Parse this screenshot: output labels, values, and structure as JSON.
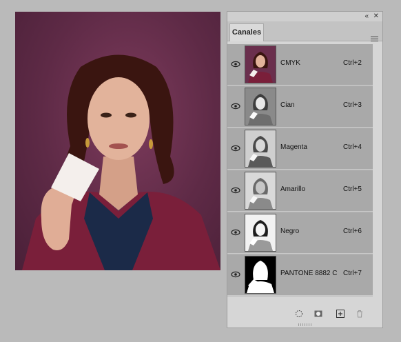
{
  "panel": {
    "tab_label": "Canales",
    "channels": [
      {
        "name": "CMYK",
        "shortcut": "Ctrl+2",
        "thumb": "color"
      },
      {
        "name": "Cian",
        "shortcut": "Ctrl+3",
        "thumb": "cyan"
      },
      {
        "name": "Magenta",
        "shortcut": "Ctrl+4",
        "thumb": "magenta"
      },
      {
        "name": "Amarillo",
        "shortcut": "Ctrl+5",
        "thumb": "yellow"
      },
      {
        "name": "Negro",
        "shortcut": "Ctrl+6",
        "thumb": "black"
      },
      {
        "name": "PANTONE 8882 C",
        "shortcut": "Ctrl+7",
        "thumb": "spot"
      }
    ]
  },
  "icons": {
    "collapse": "double-chevron-icon",
    "close": "close-icon",
    "menu": "panel-menu-icon",
    "eye": "eye-icon",
    "load_selection": "dotted-circle-icon",
    "save_selection": "mask-icon",
    "new_channel": "new-channel-icon",
    "delete": "trash-icon"
  },
  "colors": {
    "background": "#bababa",
    "panel": "#d6d6d6",
    "row": "#a9a9a9"
  }
}
